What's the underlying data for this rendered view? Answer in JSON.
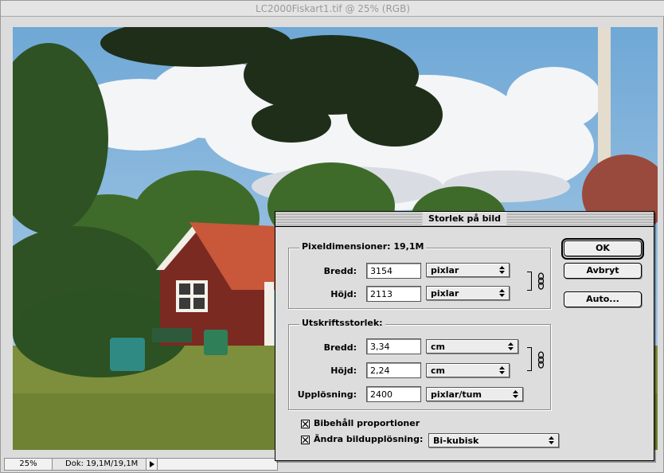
{
  "window": {
    "title": "LC2000Fiskart1.tif @ 25% (RGB)",
    "status": {
      "zoom": "25%",
      "doc_info": "Dok: 19,1M/19,1M"
    }
  },
  "dialog": {
    "title": "Storlek på bild",
    "pixel_dimensions": {
      "label": "Pixeldimensioner: 19,1M",
      "width_label": "Bredd:",
      "width_value": "3154",
      "width_unit": "pixlar",
      "height_label": "Höjd:",
      "height_value": "2113",
      "height_unit": "pixlar"
    },
    "print_size": {
      "label": "Utskriftsstorlek:",
      "width_label": "Bredd:",
      "width_value": "3,34",
      "width_unit": "cm",
      "height_label": "Höjd:",
      "height_value": "2,24",
      "height_unit": "cm",
      "resolution_label": "Upplösning:",
      "resolution_value": "2400",
      "resolution_unit": "pixlar/tum"
    },
    "constrain_label": "Bibehåll proportioner",
    "constrain_checked": true,
    "resample_label": "Ändra bildupplösning:",
    "resample_checked": true,
    "resample_method": "Bi-kubisk",
    "buttons": {
      "ok": "OK",
      "cancel": "Avbryt",
      "auto": "Auto..."
    }
  },
  "icons": [
    "chain-link-icon",
    "checkmark-icon",
    "popup-arrows-icon",
    "triangle-right-icon"
  ]
}
